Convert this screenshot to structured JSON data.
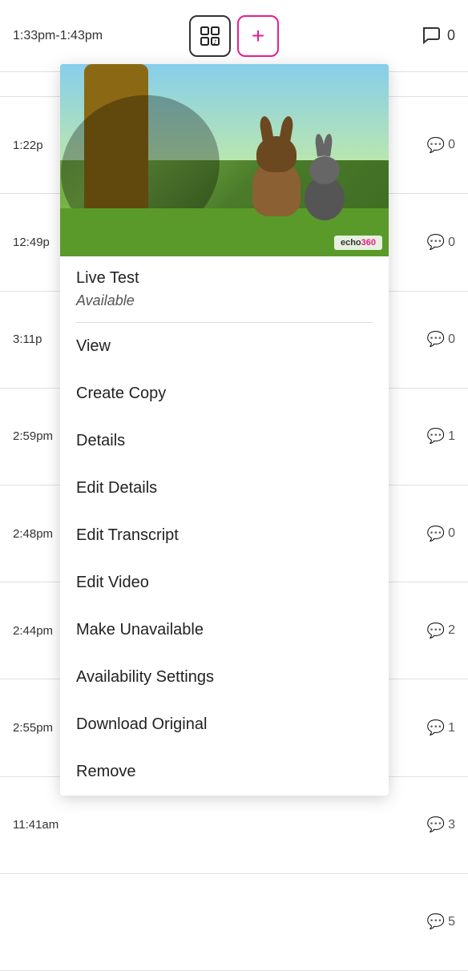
{
  "header": {
    "time_range": "1:33pm-1:43pm",
    "grid_icon": "⊞",
    "plus_icon": "+",
    "comment_count": "0"
  },
  "background_rows": [
    {
      "time": "1:22p",
      "count": "0"
    },
    {
      "time": "12:49p",
      "count": "0"
    },
    {
      "time": "3:11p",
      "count": "0"
    },
    {
      "time": "2:59pm",
      "count": "1"
    },
    {
      "time": "2:48pm",
      "count": "0"
    },
    {
      "time": "2:44pm",
      "count": "2"
    },
    {
      "time": "2:55pm",
      "count": "1"
    },
    {
      "time": "11:41am",
      "count": "3"
    },
    {
      "time": "",
      "count": ""
    },
    {
      "time": "",
      "count": ""
    },
    {
      "time": "",
      "count": "5"
    }
  ],
  "dropdown": {
    "thumbnail_alt": "Animation scene with deer and rabbit",
    "echo_brand_echo": "echo",
    "echo_brand_360": "360",
    "title": "Live Test",
    "status": "Available",
    "menu_items": [
      {
        "label": "View"
      },
      {
        "label": "Create Copy"
      },
      {
        "label": "Details"
      },
      {
        "label": "Edit Details"
      },
      {
        "label": "Edit Transcript"
      },
      {
        "label": "Edit Video"
      },
      {
        "label": "Make Unavailable"
      },
      {
        "label": "Availability Settings"
      },
      {
        "label": "Download Original"
      },
      {
        "label": "Remove"
      }
    ]
  }
}
